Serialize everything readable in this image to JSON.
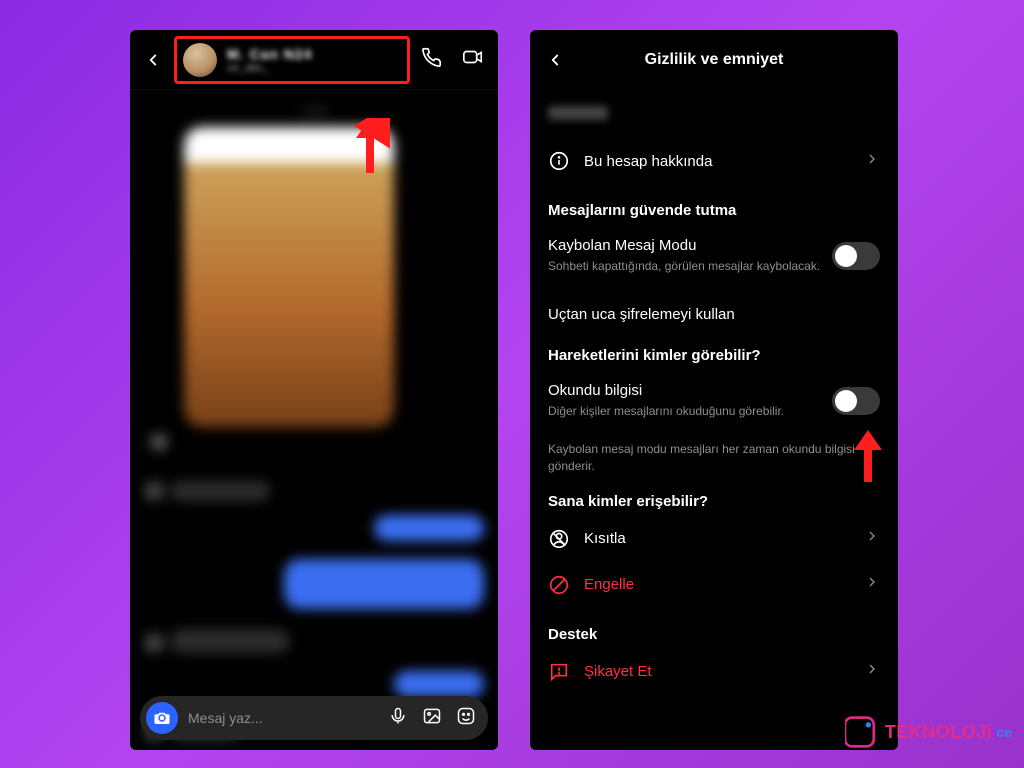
{
  "left": {
    "contact_name": "M. Can N24",
    "contact_sub": "un_abc_",
    "timestamp_label": "12:35",
    "composer_placeholder": "Mesaj yaz..."
  },
  "right": {
    "title": "Gizlilik ve emniyet",
    "about_label": "Bu hesap hakkında",
    "section_safe": "Mesajlarını güvende tutma",
    "vanish_title": "Kaybolan Mesaj Modu",
    "vanish_sub": "Sohbeti kapattığında, görülen mesajlar kaybolacak.",
    "e2e_label": "Uçtan uca şifrelemeyi kullan",
    "section_activity": "Hareketlerini kimler görebilir?",
    "read_title": "Okundu bilgisi",
    "read_sub": "Diğer kişiler mesajlarını okuduğunu görebilir.",
    "read_note": "Kaybolan mesaj modu mesajları her zaman okundu bilgisi gönderir.",
    "section_reach": "Sana kimler erişebilir?",
    "restrict_label": "Kısıtla",
    "block_label": "Engelle",
    "section_support": "Destek",
    "report_label": "Şikayet Et"
  },
  "watermark": {
    "main": "TEKNOLOJi",
    "suffix": "ce"
  }
}
